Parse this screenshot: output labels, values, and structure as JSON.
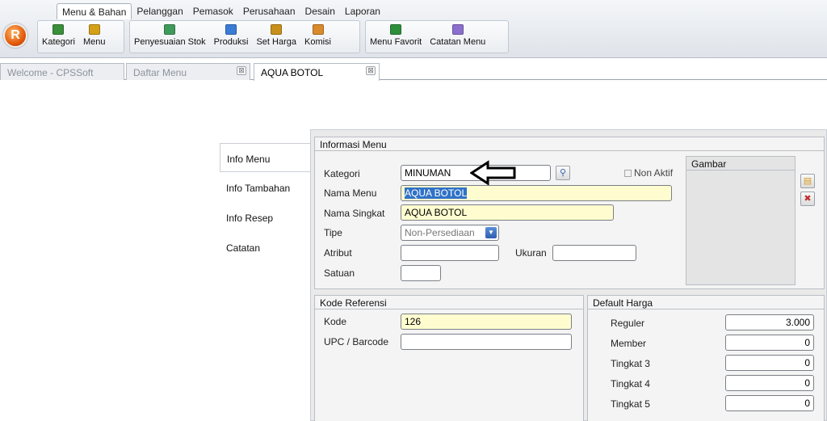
{
  "app": {
    "logo_letter": "R"
  },
  "ribbon": {
    "tabs": [
      "Menu & Bahan",
      "Pelanggan",
      "Pemasok",
      "Perusahaan",
      "Desain",
      "Laporan"
    ],
    "active_tab": "Menu & Bahan",
    "group1": [
      {
        "label": "Kategori",
        "icon": "category-icon",
        "color": "#3a8f3a"
      },
      {
        "label": "Menu",
        "icon": "menu-book-icon",
        "color": "#d4a017"
      }
    ],
    "group2": [
      {
        "label": "Penyesuaian Stok",
        "icon": "stock-adjust-icon",
        "color": "#3f9b5a"
      },
      {
        "label": "Produksi",
        "icon": "production-icon",
        "color": "#3a7bd5"
      },
      {
        "label": "Set Harga",
        "icon": "price-tag-icon",
        "color": "#c8901a"
      },
      {
        "label": "Komisi",
        "icon": "commission-icon",
        "color": "#d98a2a"
      }
    ],
    "group3": [
      {
        "label": "Menu Favorit",
        "icon": "favorite-menu-icon",
        "color": "#2d8f3a"
      },
      {
        "label": "Catatan Menu",
        "icon": "note-icon",
        "color": "#8a6fcf"
      }
    ]
  },
  "doc_tabs": [
    {
      "label": "Welcome - CPSSoft",
      "active": false
    },
    {
      "label": "Daftar Menu",
      "active": false
    },
    {
      "label": "AQUA BOTOL",
      "active": true
    }
  ],
  "close_glyph": "⊠",
  "nav": [
    "Info Menu",
    "Info Tambahan",
    "Info Resep",
    "Catatan"
  ],
  "info_menu": {
    "title": "Informasi Menu",
    "kategori_label": "Kategori",
    "kategori_value": "MINUMAN",
    "non_aktif_label": "Non Aktif",
    "nama_menu_label": "Nama Menu",
    "nama_menu_value": "AQUA BOTOL",
    "nama_singkat_label": "Nama Singkat",
    "nama_singkat_value": "AQUA BOTOL",
    "tipe_label": "Tipe",
    "tipe_value": "Non-Persediaan",
    "atribut_label": "Atribut",
    "atribut_value": "",
    "ukuran_label": "Ukuran",
    "ukuran_value": "",
    "satuan_label": "Satuan",
    "satuan_value": "",
    "gambar_title": "Gambar"
  },
  "kode_referensi": {
    "title": "Kode Referensi",
    "kode_label": "Kode",
    "kode_value": "126",
    "upc_label": "UPC / Barcode",
    "upc_value": ""
  },
  "default_harga": {
    "title": "Default Harga",
    "rows": [
      {
        "label": "Reguler",
        "value": "3.000"
      },
      {
        "label": "Member",
        "value": "0"
      },
      {
        "label": "Tingkat 3",
        "value": "0"
      },
      {
        "label": "Tingkat 4",
        "value": "0"
      },
      {
        "label": "Tingkat 5",
        "value": "0"
      }
    ]
  }
}
